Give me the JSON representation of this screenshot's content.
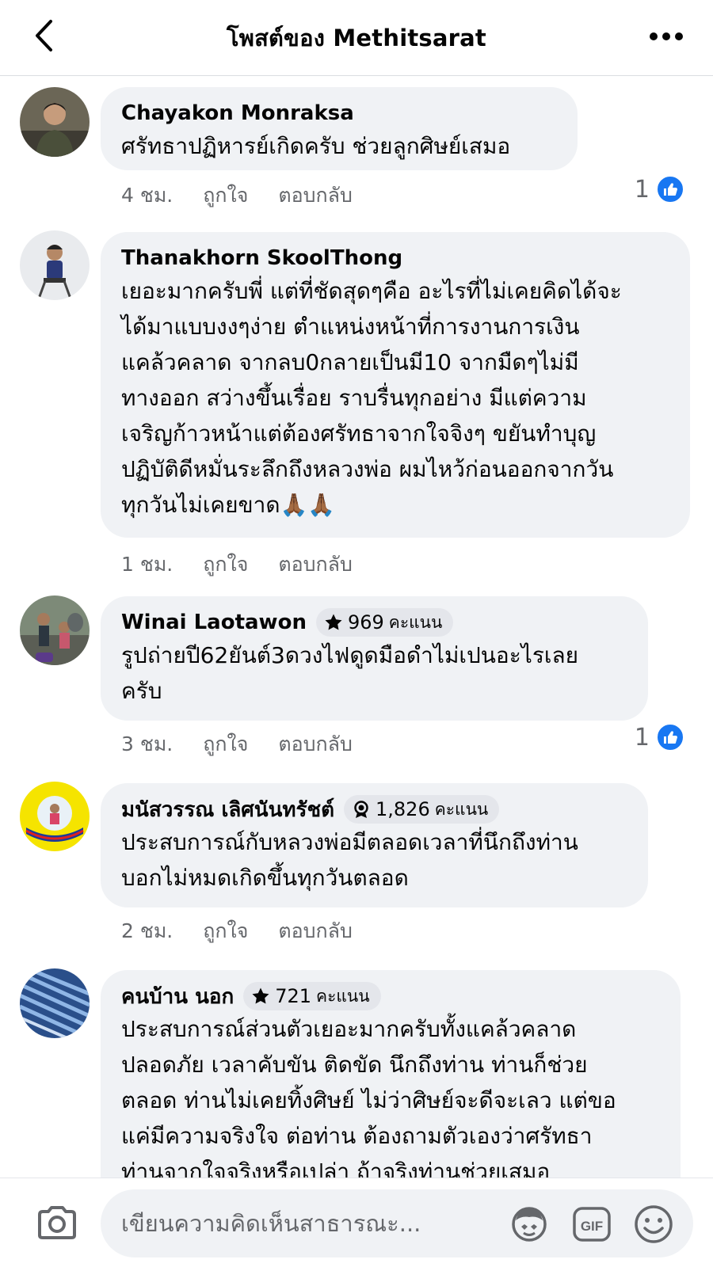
{
  "header": {
    "title": "โพสต์ของ Methitsarat"
  },
  "comments": [
    {
      "author": "Chayakon Monraksa",
      "text": [
        "ศรัทธาปฏิหารย์เกิดครับ ช่วยลูกศิษย์เสมอ"
      ],
      "time": "4 ชม.",
      "like": "ถูกใจ",
      "reply": "ตอบกลับ",
      "reactions": "1"
    },
    {
      "author": "Thanakhorn SkoolThong",
      "text": [
        "เยอะมากครับพี่ แต่ที่ชัดสุดๆคือ อะไรที่ไม่เคยคิดได้จะ",
        "ได้มาแบบงงๆง่าย ตำแหน่งหน้าที่การงานการเงิน",
        "แคล้วคลาด  จากลบ0กลายเป็นมี10 จากมืดๆไม่มี",
        "ทางออก สว่างขึ้นเรื่อย ราบรื่นทุกอย่าง มีแต่ความ",
        "เจริญก้าวหน้าแต่ต้องศรัทธาจากใจจิงๆ ขยันทำบุญ",
        "ปฏิบัติดีหมั่นระลึกถึงหลวงพ่อ ผมไหว้ก่อนออกจากวัน",
        "ทุกวันไม่เคยขาด🙏🏾🙏🏾"
      ],
      "time": "1 ชม.",
      "like": "ถูกใจ",
      "reply": "ตอบกลับ"
    },
    {
      "author": "Winai Laotawon",
      "badge": {
        "points": "969",
        "unit": "คะแนน",
        "icon": "star-icon"
      },
      "text": [
        "รูปถ่ายปี62ยันต์3ดวงไฟดูดมือดำไม่เปนอะไรเลย",
        "ครับ"
      ],
      "time": "3 ชม.",
      "like": "ถูกใจ",
      "reply": "ตอบกลับ",
      "reactions": "1"
    },
    {
      "author": "มนัสวรรณ เลิศนันทรัชต์",
      "badge": {
        "points": "1,826",
        "unit": "คะแนน",
        "icon": "award-icon"
      },
      "text": [
        "ประสบการณ์กับหลวงพ่อมีตลอดเวลาที่นึกถึงท่าน",
        "บอกไม่หมดเกิดขึ้นทุกวันตลอด"
      ],
      "time": "2 ชม.",
      "like": "ถูกใจ",
      "reply": "ตอบกลับ"
    },
    {
      "author": "คนบ้าน นอก",
      "badge": {
        "points": "721",
        "unit": "คะแนน",
        "icon": "star-icon"
      },
      "text": [
        "ประสบการณ์ส่วนตัวเยอะมากครับทั้งแคล้วคลาด",
        "ปลอดภัย เวลาคับขัน ติดขัด นึกถึงท่าน ท่านก็ช่วย",
        "ตลอด ท่านไม่เคยทิ้งศิษย์ ไม่ว่าศิษย์จะดีจะเลว แต่ขอ",
        "แค่มีความจริงใจ ต่อท่าน ต้องถามตัวเองว่าศรัทธา",
        "ท่านจากใจจริงหรือเปล่า ถ้าจริงท่านช่วยเสมอ"
      ]
    }
  ],
  "composer": {
    "placeholder": "เขียนความคิดเห็นสาธารณะ..."
  },
  "colors": {
    "accent": "#1877f2",
    "bubble": "#f0f2f5",
    "meta": "#65676b"
  }
}
